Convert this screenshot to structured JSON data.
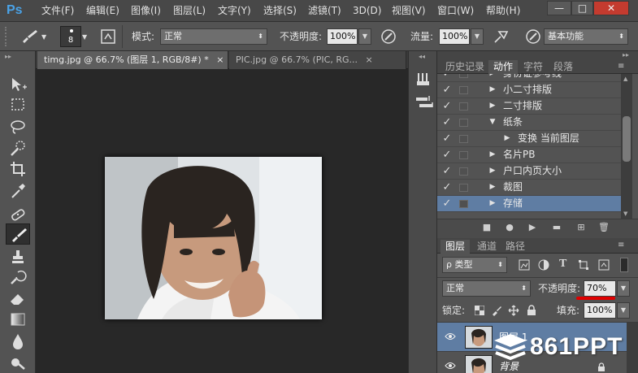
{
  "app": {
    "logo": "Ps",
    "accent": "#4aa3e8"
  },
  "menu": {
    "items": [
      "文件(F)",
      "编辑(E)",
      "图像(I)",
      "图层(L)",
      "文字(Y)",
      "选择(S)",
      "滤镜(T)",
      "3D(D)",
      "视图(V)",
      "窗口(W)",
      "帮助(H)"
    ]
  },
  "window_controls": {
    "minimize": "—",
    "restore": "□",
    "close": "✕"
  },
  "options": {
    "brush_size": "8",
    "mode_label": "模式:",
    "mode_value": "正常",
    "opacity_label": "不透明度:",
    "opacity_value": "100%",
    "flow_label": "流量:",
    "flow_value": "100%",
    "workspace": "基本功能"
  },
  "tabs": [
    {
      "label": "timg.jpg @ 66.7% (图层 1, RGB/8#) *",
      "close": "×"
    },
    {
      "label": "PIC.jpg @ 66.7% (PIC, RG...",
      "close": "×"
    }
  ],
  "actions_panel": {
    "tabs": [
      "历史记录",
      "动作",
      "字符",
      "段落"
    ],
    "active_tab": 1,
    "rows": [
      {
        "label": "身份证参考线",
        "check": "✓",
        "tri": "▶",
        "indent": 0
      },
      {
        "label": "小二寸排版",
        "check": "✓",
        "tri": "▶",
        "indent": 0
      },
      {
        "label": "二寸排版",
        "check": "✓",
        "tri": "▶",
        "indent": 0
      },
      {
        "label": "纸条",
        "check": "✓",
        "tri": "▼",
        "indent": 0
      },
      {
        "label": "变换 当前图层",
        "check": "✓",
        "tri": "▶",
        "indent": 1
      },
      {
        "label": "名片PB",
        "check": "✓",
        "tri": "▶",
        "indent": 0
      },
      {
        "label": "户口内页大小",
        "check": "✓",
        "tri": "▶",
        "indent": 0
      },
      {
        "label": "裁图",
        "check": "✓",
        "tri": "▶",
        "indent": 0
      },
      {
        "label": "存储",
        "check": "✓",
        "tri": "▶",
        "indent": 0,
        "selected": true
      }
    ],
    "bottom_buttons": [
      "■",
      "●",
      "▶",
      "▬",
      "⊞",
      "🗑"
    ]
  },
  "layers_panel": {
    "tabs": [
      "图层",
      "通道",
      "路径"
    ],
    "filter_label": "ρ 类型",
    "blend_mode": "正常",
    "opacity_label": "不透明度:",
    "opacity_value": "70%",
    "lock_label": "锁定:",
    "fill_label": "填充:",
    "fill_value": "100%",
    "layers": [
      {
        "name": "图层 1"
      },
      {
        "name": "背景",
        "locked": true
      }
    ],
    "highlight_color": "#e00000"
  },
  "watermark": "861PPT"
}
